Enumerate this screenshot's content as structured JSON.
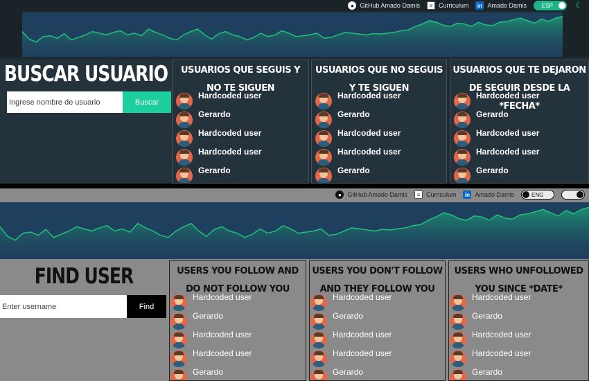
{
  "dark": {
    "nav": {
      "github": "GitHub Amado Damis",
      "curriculum": "Curriculum",
      "linkedin": "Amado Damis",
      "lang": "ESP"
    },
    "search": {
      "title": "BUSCAR USUARIO",
      "placeholder": "Ingrese nombre de usuario",
      "button": "Buscar"
    },
    "columns": [
      {
        "title": "USUARIOS QUE SEGUIS Y NO TE SIGUEN",
        "users": [
          "Hardcoded user",
          "Gerardo",
          "Hardcoded user",
          "Hardcoded user",
          "Gerardo"
        ]
      },
      {
        "title": "USUARIOS QUE NO SEGUIS Y TE SIGUEN",
        "users": [
          "Hardcoded user",
          "Gerardo",
          "Hardcoded user",
          "Hardcoded user",
          "Gerardo"
        ]
      },
      {
        "title": "USUARIOS QUE TE DEJARON DE SEGUIR DESDE LA *FECHA*",
        "users": [
          "Hardcoded user",
          "Gerardo",
          "Hardcoded user",
          "Hardcoded user",
          "Gerardo"
        ]
      }
    ]
  },
  "light": {
    "nav": {
      "github": "GitHub Amado Damis",
      "curriculum": "Curriculum",
      "linkedin": "Amado Damis",
      "lang": "ENG"
    },
    "search": {
      "title": "FIND USER",
      "placeholder": "Enter username",
      "button": "Find"
    },
    "columns": [
      {
        "title": "USERS YOU FOLLOW AND DO NOT FOLLOW YOU",
        "users": [
          "Hardcoded user",
          "Gerardo",
          "Hardcoded user",
          "Hardcoded user",
          "Gerardo"
        ]
      },
      {
        "title": "USERS YOU DON'T FOLLOW AND THEY FOLLOW YOU",
        "users": [
          "Hardcoded user",
          "Gerardo",
          "Hardcoded user",
          "Hardcoded user",
          "Gerardo"
        ]
      },
      {
        "title": "USERS WHO UNFOLLOWED YOU SINCE *DATE*",
        "users": [
          "Hardcoded user",
          "Gerardo",
          "Hardcoded user",
          "Hardcoded user",
          "Gerardo"
        ]
      }
    ]
  },
  "colors": {
    "accent": "#1dcf9c",
    "chart_line": "#22c07a",
    "chart_bg": "#1f3f5e",
    "dark_bg": "#24323c",
    "light_bg": "#8a8a8a"
  },
  "icons": {
    "github": "github-icon",
    "curriculum": "curriculum-icon",
    "linkedin": "linkedin-icon",
    "theme": "moon-icon",
    "avatar": "avatar-icon"
  },
  "chart_data": {
    "type": "area",
    "series": [
      {
        "values": [
          0.6,
          0.42,
          0.35,
          0.48,
          0.5,
          0.44,
          0.55,
          0.4,
          0.46,
          0.52,
          0.6,
          0.56,
          0.52,
          0.58,
          0.62,
          0.52,
          0.56,
          0.5,
          0.66,
          0.58,
          0.52,
          0.44,
          0.4,
          0.52,
          0.6,
          0.66,
          0.52,
          0.42,
          0.55,
          0.6,
          0.52,
          0.48,
          0.4,
          0.46,
          0.56,
          0.48,
          0.52,
          0.62,
          0.56,
          0.48,
          0.5,
          0.52,
          0.56,
          0.44,
          0.46,
          0.52,
          0.58,
          0.56,
          0.54,
          0.52,
          0.55,
          0.54,
          0.56,
          0.58,
          0.62,
          0.64,
          0.72,
          0.78,
          0.86,
          0.82,
          0.75,
          0.72,
          0.8,
          0.78,
          0.72,
          0.82,
          0.76,
          0.74,
          0.82,
          0.84,
          0.88,
          0.92,
          0.86,
          0.8,
          0.9,
          0.84,
          0.92,
          0.96
        ]
      }
    ],
    "grid": false
  }
}
